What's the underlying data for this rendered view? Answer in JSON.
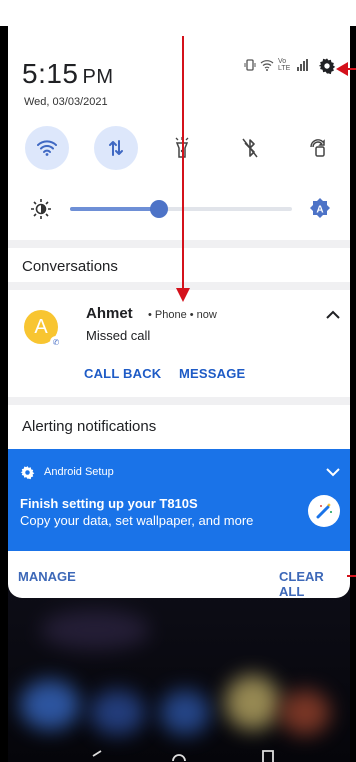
{
  "clock": {
    "time": "5:15",
    "ampm": "PM",
    "date": "Wed, 03/03/2021"
  },
  "status_icons": [
    "vibrate-icon",
    "wifi-calling-icon",
    "volte-icon",
    "signal-icon"
  ],
  "status_text": {
    "volte": "Vo LTE"
  },
  "quick_settings": [
    {
      "name": "wifi",
      "icon": "wifi-icon",
      "active": true
    },
    {
      "name": "mobile-data",
      "icon": "data-arrows-icon",
      "active": true
    },
    {
      "name": "flashlight",
      "icon": "flashlight-icon",
      "active": false
    },
    {
      "name": "bluetooth",
      "icon": "bluetooth-off-icon",
      "active": false
    },
    {
      "name": "auto-rotate",
      "icon": "rotate-icon",
      "active": false
    }
  ],
  "brightness": {
    "level": 0.4,
    "auto_label": "A"
  },
  "sections": {
    "conversations": "Conversations",
    "alerting": "Alerting notifications"
  },
  "conversation": {
    "avatar_letter": "A",
    "name": "Ahmet",
    "meta": "•  Phone  •  now",
    "message": "Missed call",
    "actions": [
      "CALL BACK",
      "MESSAGE"
    ]
  },
  "setup": {
    "app_name": "Android Setup",
    "title": "Finish setting up your T810S",
    "body": "Copy your data, set wallpaper, and more"
  },
  "footer": {
    "manage": "MANAGE",
    "clear_all": "CLEAR ALL"
  },
  "colors": {
    "accent": "#1a73e8",
    "annotation": "#d4111b",
    "avatar": "#f8c531"
  }
}
